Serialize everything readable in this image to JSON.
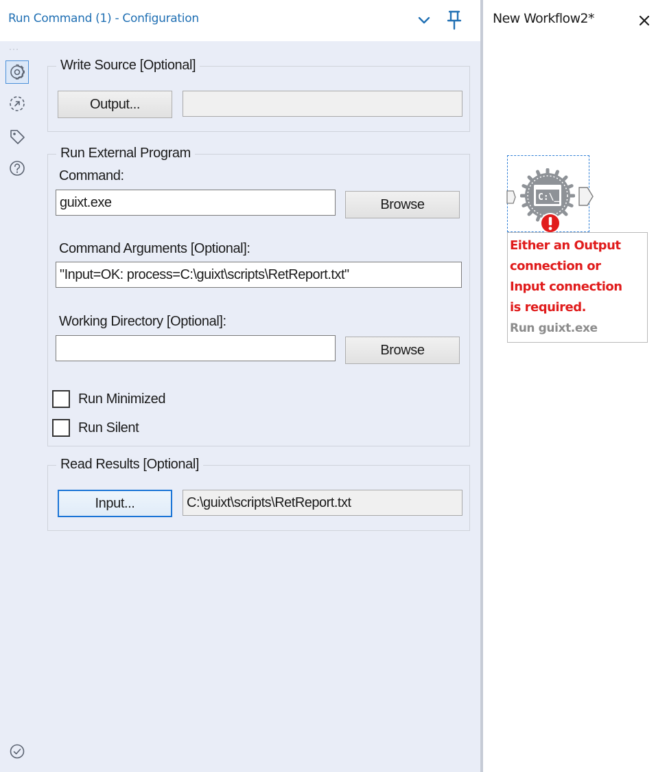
{
  "header": {
    "title": "Run Command (1) - Configuration",
    "collapse_icon": "chevron-down-icon",
    "pin_icon": "pin-icon"
  },
  "toolbar": {
    "more_icon": "ellipsis-icon",
    "items": [
      {
        "icon": "gear-icon",
        "active": true
      },
      {
        "icon": "connection-icon",
        "active": false
      },
      {
        "icon": "tag-icon",
        "active": false
      },
      {
        "icon": "help-icon",
        "active": false
      }
    ],
    "footer_icon": "check-circle-icon"
  },
  "write_source": {
    "legend": "Write Source [Optional]",
    "button": "Output...",
    "path": ""
  },
  "run_external": {
    "legend": "Run External Program",
    "command_label": "Command:",
    "command_value": "guixt.exe",
    "browse_label": "Browse",
    "args_label": "Command Arguments [Optional]:",
    "args_value": "\"Input=OK: process=C:\\guixt\\scripts\\RetReport.txt\"",
    "workdir_label": "Working Directory [Optional]:",
    "workdir_value": "",
    "workdir_browse_label": "Browse",
    "run_minimized_label": "Run Minimized",
    "run_minimized_checked": false,
    "run_silent_label": "Run Silent",
    "run_silent_checked": false
  },
  "read_results": {
    "legend": "Read Results [Optional]",
    "button": "Input...",
    "path": "C:\\guixt\\scripts\\RetReport.txt"
  },
  "canvas": {
    "tab_title": "New Workflow2*",
    "close_icon": "close-icon",
    "tool": {
      "icon": "run-command-icon",
      "icon_text": "C:\\_",
      "error_icon": "error-badge-icon",
      "error_message": "Either an Output connection or Input connection is required.",
      "error_lines": [
        "Either an Output",
        "connection or",
        "Input connection",
        "is required."
      ],
      "annotation": "Run guixt.exe"
    }
  },
  "colors": {
    "accent": "#1f6fb3",
    "panel_bg": "#e9edf7",
    "error": "#e01b1b",
    "annotation_gray": "#8c8c8c",
    "focus_border": "#1a74d6"
  }
}
